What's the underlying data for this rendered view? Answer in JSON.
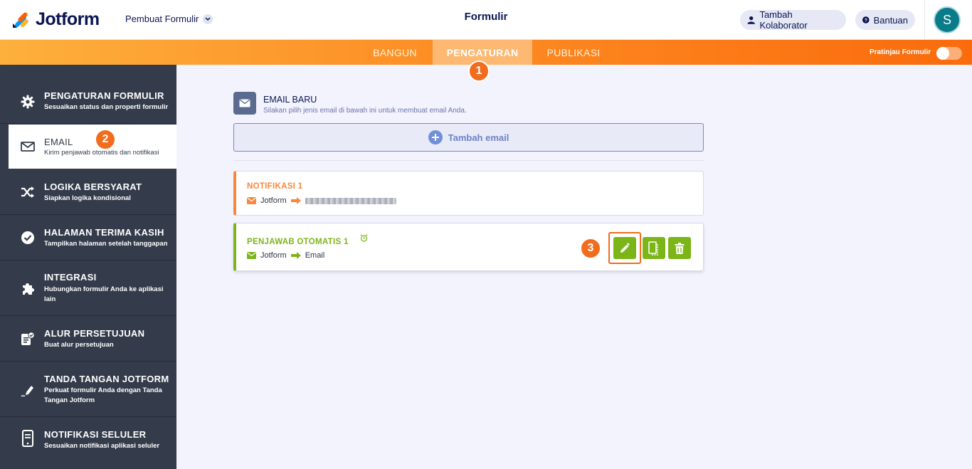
{
  "header": {
    "brand": "Jotform",
    "builder_select": "Pembuat Formulir",
    "form_title": "Formulir",
    "collab_label": "Tambah Kolaborator",
    "help_label": "Bantuan",
    "avatar_initial": "S"
  },
  "nav": {
    "tabs": [
      {
        "label": "BANGUN",
        "active": false
      },
      {
        "label": "PENGATURAN",
        "active": true
      },
      {
        "label": "PUBLIKASI",
        "active": false
      }
    ],
    "preview_label": "Pratinjau Formulir",
    "preview_on": false
  },
  "steps": [
    "1",
    "2",
    "3"
  ],
  "sidebar": {
    "items": [
      {
        "title": "PENGATURAN FORMULIR",
        "desc": "Sesuaikan status dan properti formulir",
        "icon": "gear-icon"
      },
      {
        "title": "EMAIL",
        "desc": "Kirim penjawab otomatis dan notifikasi",
        "icon": "envelope-icon",
        "active": true
      },
      {
        "title": "LOGIKA BERSYARAT",
        "desc": "Siapkan logika kondisional",
        "icon": "shuffle-icon"
      },
      {
        "title": "HALAMAN TERIMA KASIH",
        "desc": "Tampilkan halaman setelah tanggapan",
        "icon": "check-circle-icon"
      },
      {
        "title": "INTEGRASI",
        "desc": "Hubungkan formulir Anda ke aplikasi lain",
        "icon": "puzzle-icon"
      },
      {
        "title": "ALUR PERSETUJUAN",
        "desc": "Buat alur persetujuan",
        "icon": "approval-icon"
      },
      {
        "title": "TANDA TANGAN JOTFORM",
        "desc": "Perkuat formulir Anda dengan Tanda Tangan Jotform",
        "icon": "pen-icon"
      },
      {
        "title": "NOTIFIKASI SELULER",
        "desc": "Sesuaikan notifikasi aplikasi seluler",
        "icon": "mobile-icon"
      }
    ]
  },
  "main": {
    "section_title": "EMAIL BARU",
    "section_sub": "Silakan pilih jenis email di bawah ini untuk membuat email Anda.",
    "add_email_label": "Tambah email",
    "emails": [
      {
        "title": "NOTIFIKASI 1",
        "from": "Jotform",
        "to": ""
      },
      {
        "title": "PENJAWAB OTOMATIS 1",
        "from": "Jotform",
        "to": "Email"
      }
    ]
  },
  "colors": {
    "orange": "#f5883c",
    "green": "#7cb518",
    "sidebar": "#343c4b",
    "navy": "#0a1551"
  }
}
